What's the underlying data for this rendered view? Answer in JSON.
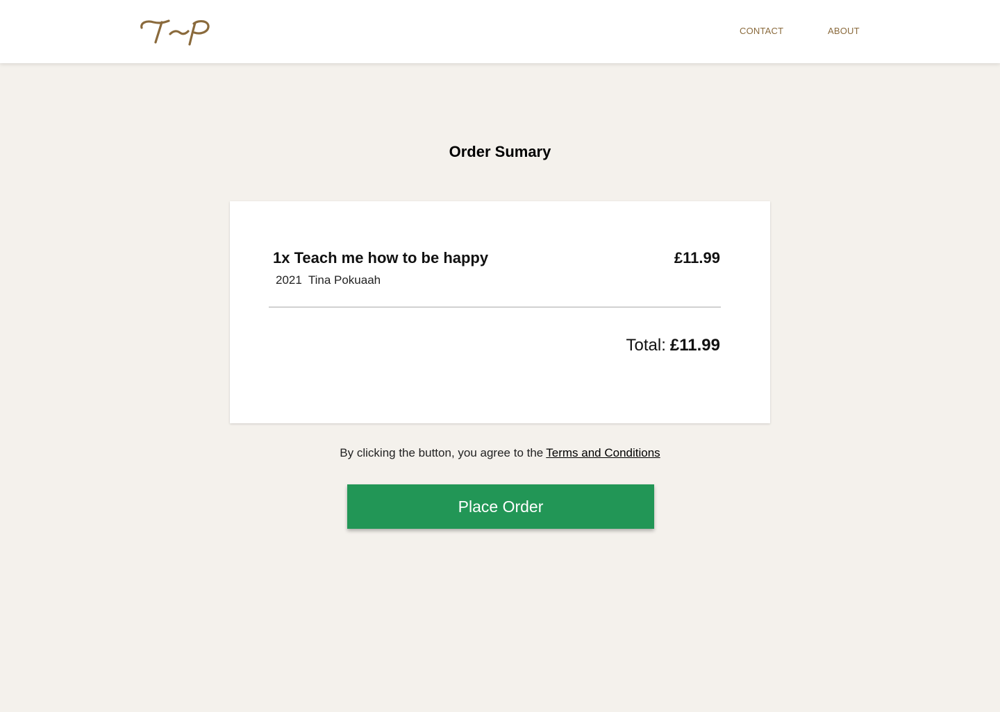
{
  "header": {
    "logo_text": "T-P",
    "nav": [
      {
        "label": "CONTACT"
      },
      {
        "label": "ABOUT"
      }
    ]
  },
  "main": {
    "title": "Order Sumary",
    "order": {
      "item_title": "1x Teach me how to be happy",
      "item_price": "£11.99",
      "item_year": "2021",
      "item_author": "Tina Pokuaah",
      "total_label": "Total:",
      "total_value": "£11.99"
    },
    "terms_text": "By clicking the button, you agree to the",
    "terms_link": "Terms and Conditions",
    "place_order_label": "Place Order"
  },
  "colors": {
    "background": "#f4f1ec",
    "brand_gold": "#8a6a3c",
    "button_green": "#229656"
  }
}
